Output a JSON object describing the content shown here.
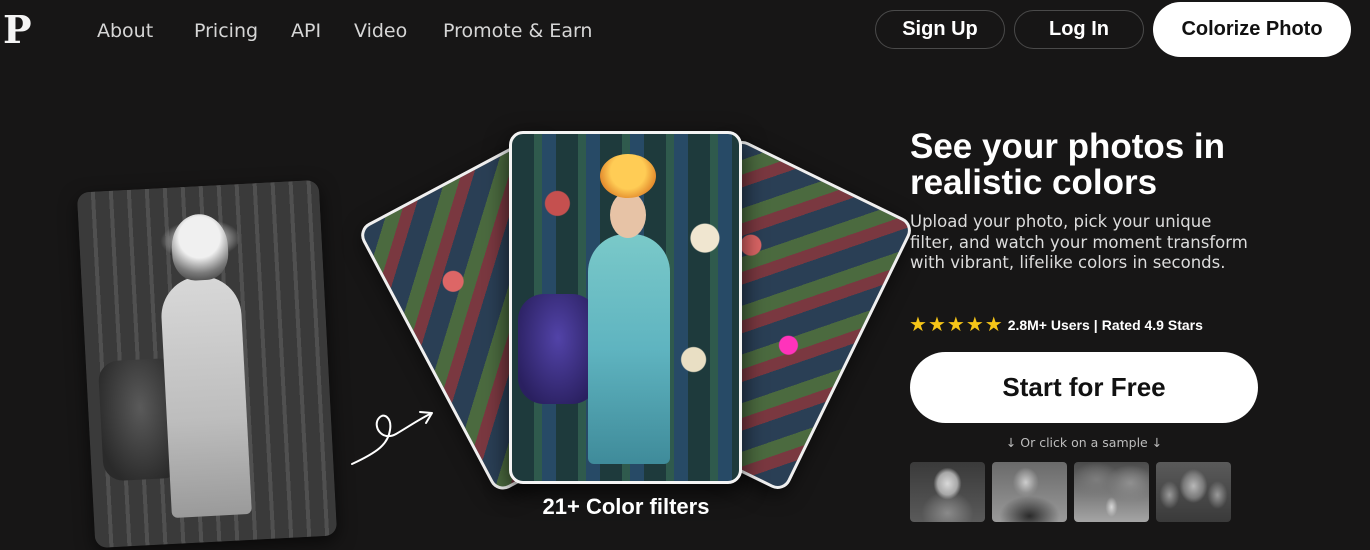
{
  "nav": {
    "logo": "P",
    "links": [
      "About",
      "Pricing",
      "API",
      "Video",
      "Promote & Earn"
    ],
    "signup_label": "Sign Up",
    "login_label": "Log In",
    "cta_label": "Colorize Photo"
  },
  "showcase": {
    "filters_label": "21+ Color filters"
  },
  "hero": {
    "title": "See your photos in realistic colors",
    "subtitle": "Upload your photo, pick your unique filter, and watch your moment transform with vibrant, lifelike colors in seconds.",
    "stars": [
      "★",
      "★",
      "★",
      "★",
      "★"
    ],
    "users": "2.8M+ Users",
    "separator": "|",
    "rating": "Rated 4.9 Stars",
    "start_label": "Start for Free",
    "sample_hint": "↓ Or click on a sample ↓"
  },
  "colors": {
    "background": "#171616",
    "star": "#f5c518",
    "button_bg": "#ffffff",
    "button_text": "#111111"
  }
}
